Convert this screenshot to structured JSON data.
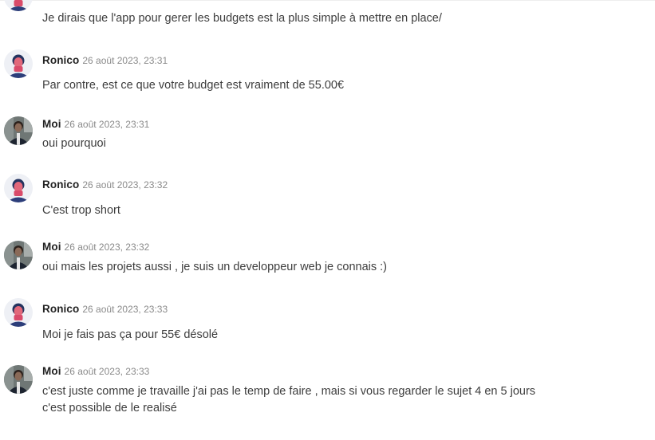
{
  "messages": [
    {
      "author": "",
      "time": "",
      "avatar_icon": "person-avatar-icon",
      "text": "Je dirais que l'app pour gerer les budgets est la plus simple à mettre en place/"
    },
    {
      "author": "Ronico",
      "time": "26 août 2023, 23:31",
      "avatar_icon": "person-avatar-icon",
      "text": "Par contre, est ce que votre budget est vraiment de 55.00€"
    },
    {
      "author": "Moi",
      "time": "26 août 2023, 23:31",
      "avatar_icon": "person-avatar-icon",
      "text": "oui pourquoi"
    },
    {
      "author": "Ronico",
      "time": "26 août 2023, 23:32",
      "avatar_icon": "person-avatar-icon",
      "text": "C'est trop short"
    },
    {
      "author": "Moi",
      "time": "26 août 2023, 23:32",
      "avatar_icon": "person-avatar-icon",
      "text": "oui mais les projets aussi , je suis un developpeur web je connais :)"
    },
    {
      "author": "Ronico",
      "time": "26 août 2023, 23:33",
      "avatar_icon": "person-avatar-icon",
      "text": "Moi je fais pas ça pour 55€ désolé"
    },
    {
      "author": "Moi",
      "time": "26 août 2023, 23:33",
      "avatar_icon": "person-avatar-icon",
      "text": "c'est juste comme je travaille j'ai pas le temp de faire , mais si vous regarder le sujet 4 en 5 jours c'est possible de le realisé"
    }
  ]
}
